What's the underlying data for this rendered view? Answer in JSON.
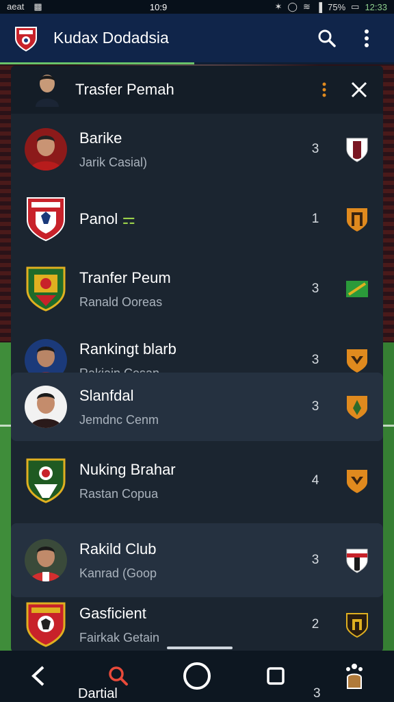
{
  "status_bar": {
    "left_text": "aeat",
    "center_time": "10:9",
    "battery": "75%",
    "right_time": "12:33"
  },
  "app_bar": {
    "title": "Kudax Dodadsia",
    "icons": [
      "crest-logo",
      "search-icon",
      "more-vert-icon"
    ]
  },
  "sheet": {
    "title": "Trasfer Pemah",
    "rows": [
      {
        "name": "Barike",
        "sub": "Jarik Casial)",
        "rank": "3",
        "visual": "avatar",
        "badge": "shield-white-red"
      },
      {
        "name": "Panol",
        "sub": "",
        "rank": "1",
        "visual": "crest-red",
        "badge": "shield-orange"
      },
      {
        "name": "Tranfer Peum",
        "sub": "Ranald Ooreas",
        "rank": "3",
        "visual": "crest-green",
        "badge": "flag-green"
      },
      {
        "name": "Rankingt blarb",
        "sub": "Rakiain Cesan",
        "rank": "3",
        "visual": "avatar",
        "badge": "shield-orange"
      },
      {
        "name": "Slanfdal",
        "sub": "Jemdnc Cenm",
        "rank": "3",
        "visual": "avatar",
        "badge": "shield-orange"
      },
      {
        "name": "Nuking Brahar",
        "sub": "Rastan Copua",
        "rank": "4",
        "visual": "crest-green",
        "badge": "shield-orange"
      },
      {
        "name": "Rakild Club",
        "sub": "Kanrad (Goop",
        "rank": "3",
        "visual": "avatar",
        "badge": "shield-white-red"
      },
      {
        "name": "Gasficient",
        "sub": "Fairkak Getain",
        "rank": "2",
        "visual": "crest-red",
        "badge": "shield-dark"
      }
    ]
  },
  "nav_bar": {
    "items": [
      "back-icon",
      "search-icon",
      "home-icon",
      "recents-icon",
      "accessibility-icon"
    ],
    "peek_label": "Dartial",
    "peek_rank": "3"
  },
  "colors": {
    "app_bar": "#10254a",
    "sheet": "#1b2530",
    "accent_green": "#69c36a",
    "badge_orange": "#e08a1e",
    "crest_red": "#c8222a"
  }
}
